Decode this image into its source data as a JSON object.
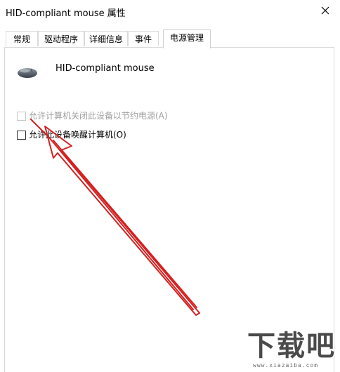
{
  "window": {
    "title": "HID-compliant mouse 属性"
  },
  "tabs": [
    {
      "label": "常规"
    },
    {
      "label": "驱动程序"
    },
    {
      "label": "详细信息"
    },
    {
      "label": "事件"
    },
    {
      "label": "电源管理",
      "active": true
    }
  ],
  "device": {
    "name": "HID-compliant mouse",
    "icon": "mouse-icon"
  },
  "options": [
    {
      "label": "允许计算机关闭此设备以节约电源(A)",
      "checked": false,
      "enabled": false
    },
    {
      "label": "允许此设备唤醒计算机(O)",
      "checked": false,
      "enabled": true
    }
  ],
  "annotation": {
    "arrow_color": "#d42020"
  },
  "watermark": {
    "text": "下载吧",
    "url": "www.xiazaiba.com"
  }
}
